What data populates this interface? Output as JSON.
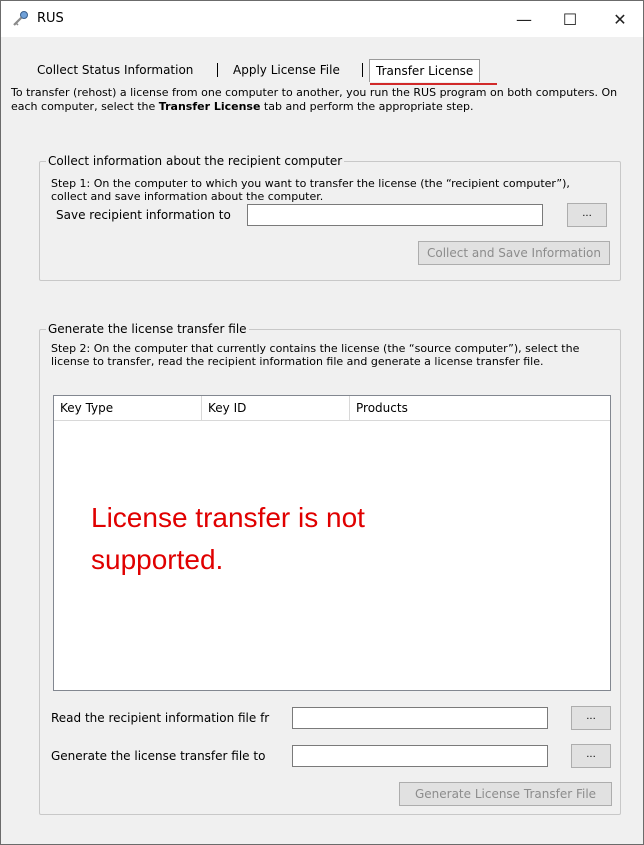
{
  "window": {
    "title": "RUS",
    "minimize_glyph": "—",
    "maximize_glyph": "☐",
    "close_glyph": "✕"
  },
  "tabs": [
    {
      "label": "Collect Status Information"
    },
    {
      "label": "Apply License File"
    },
    {
      "label": "Transfer License",
      "active": true
    }
  ],
  "intro": {
    "part1": "To transfer (rehost) a license from one computer to another, you run the RUS program on both computers. On each computer, select the ",
    "bold": "Transfer License",
    "part2": " tab and perform the appropriate step."
  },
  "collect_group": {
    "legend": "Collect information about the recipient computer",
    "step_text": "Step 1: On the computer to which you want to transfer the license (the “recipient computer”), collect and save information about the computer.",
    "save_label": "Save recipient information to",
    "save_value": "",
    "browse_label": "...",
    "collect_button": "Collect and Save Information"
  },
  "generate_group": {
    "legend": "Generate the license transfer file",
    "step_text": "Step 2: On the computer that currently contains the license (the “source computer”), select the license to transfer, read the recipient information file and generate a license transfer file.",
    "columns": [
      "Key Type",
      "Key ID",
      "Products"
    ],
    "rows": [],
    "read_label": "Read the recipient information file fr",
    "read_value": "",
    "generate_to_label": "Generate the license transfer file to",
    "generate_to_value": "",
    "browse_label": "...",
    "generate_button": "Generate License Transfer File"
  },
  "overlay_message": "License transfer is not supported.",
  "colors": {
    "overlay_text": "#e00000",
    "active_tab_underline": "#d12a2a"
  }
}
